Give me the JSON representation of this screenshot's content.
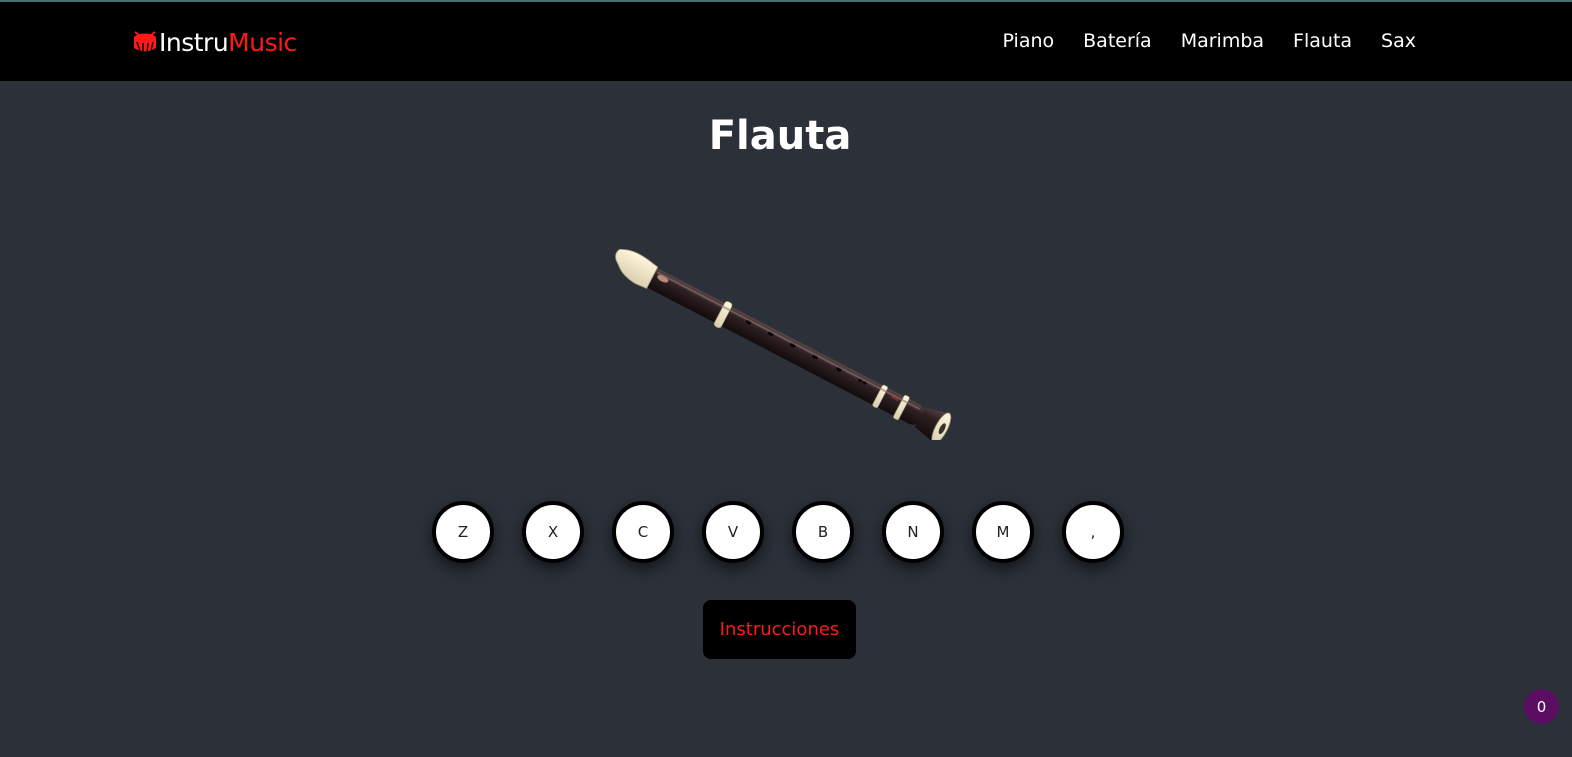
{
  "brand": {
    "name_part1": "Instru",
    "name_part2": "Music",
    "logo_icon": "drum-icon",
    "accent_color": "#ff1a1a"
  },
  "nav": {
    "items": [
      {
        "label": "Piano"
      },
      {
        "label": "Batería"
      },
      {
        "label": "Marimba"
      },
      {
        "label": "Flauta"
      },
      {
        "label": "Sax"
      }
    ]
  },
  "page": {
    "title": "Flauta",
    "instrument_image": "recorder-flute"
  },
  "keys": [
    {
      "label": "Z"
    },
    {
      "label": "X"
    },
    {
      "label": "C"
    },
    {
      "label": "V"
    },
    {
      "label": "B"
    },
    {
      "label": "N"
    },
    {
      "label": "M"
    },
    {
      "label": ","
    }
  ],
  "instructions_button": {
    "label": "Instrucciones"
  },
  "counter_badge": {
    "value": "0",
    "color": "#5b0d62"
  },
  "colors": {
    "background": "#2b3039",
    "navbar": "#000000"
  }
}
